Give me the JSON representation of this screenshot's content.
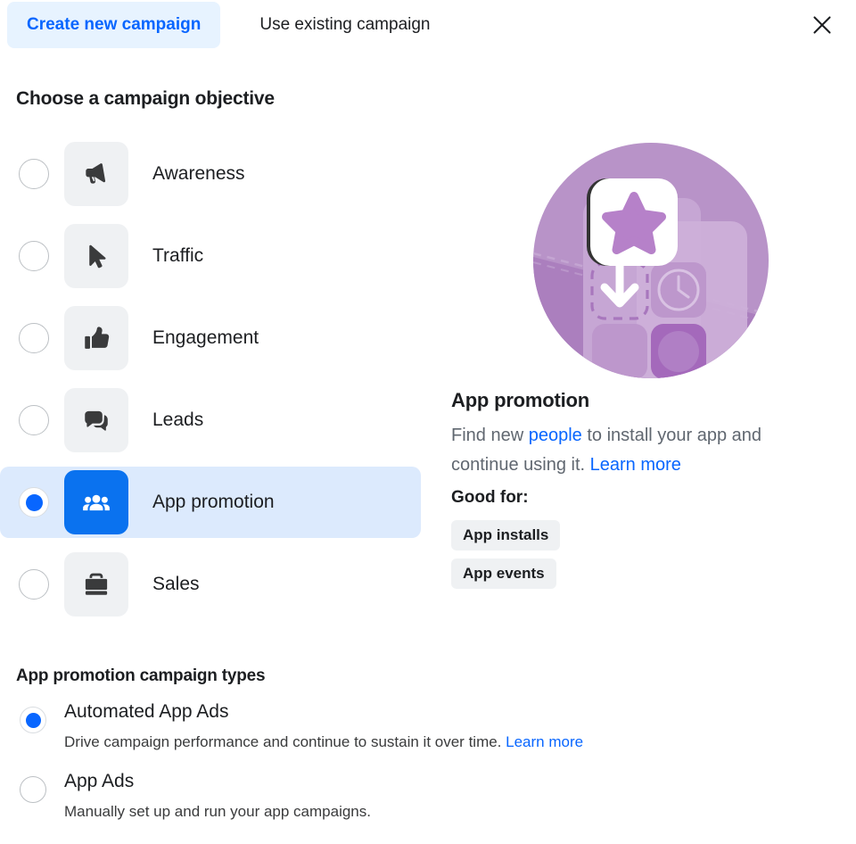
{
  "colors": {
    "accent_blue": "#0866ff",
    "tab_active_bg": "#e7f3ff",
    "selected_row_bg": "#dceafd",
    "icon_tile_bg": "#eff1f3",
    "selected_icon_tile_bg": "#0a72ef",
    "text_primary": "#1c1e21",
    "text_secondary": "#606770",
    "illustration_purple": "#b893c8"
  },
  "tabs": {
    "create_new": "Create new campaign",
    "use_existing": "Use existing campaign",
    "close_icon": "close-icon"
  },
  "objective_section": {
    "heading": "Choose a campaign objective",
    "options": [
      {
        "label": "Awareness",
        "icon": "megaphone-icon",
        "selected": false
      },
      {
        "label": "Traffic",
        "icon": "cursor-icon",
        "selected": false
      },
      {
        "label": "Engagement",
        "icon": "thumbs-up-icon",
        "selected": false
      },
      {
        "label": "Leads",
        "icon": "chat-bubbles-icon",
        "selected": false
      },
      {
        "label": "App promotion",
        "icon": "people-icon",
        "selected": true
      },
      {
        "label": "Sales",
        "icon": "briefcase-icon",
        "selected": false
      }
    ]
  },
  "info_panel": {
    "illustration": "app-promotion-illustration",
    "title": "App promotion",
    "description_part1": "Find new ",
    "description_link1": "people",
    "description_part2": " to install your app and continue using it. ",
    "description_link2": "Learn more",
    "good_for_label": "Good for:",
    "chips": [
      "App installs",
      "App events"
    ]
  },
  "campaign_types": {
    "heading": "App promotion campaign types",
    "options": [
      {
        "label": "Automated App Ads",
        "description": "Drive campaign performance and continue to sustain it over time. ",
        "link": "Learn more",
        "selected": true
      },
      {
        "label": "App Ads",
        "description": "Manually set up and run your app campaigns.",
        "link": "",
        "selected": false
      }
    ]
  }
}
